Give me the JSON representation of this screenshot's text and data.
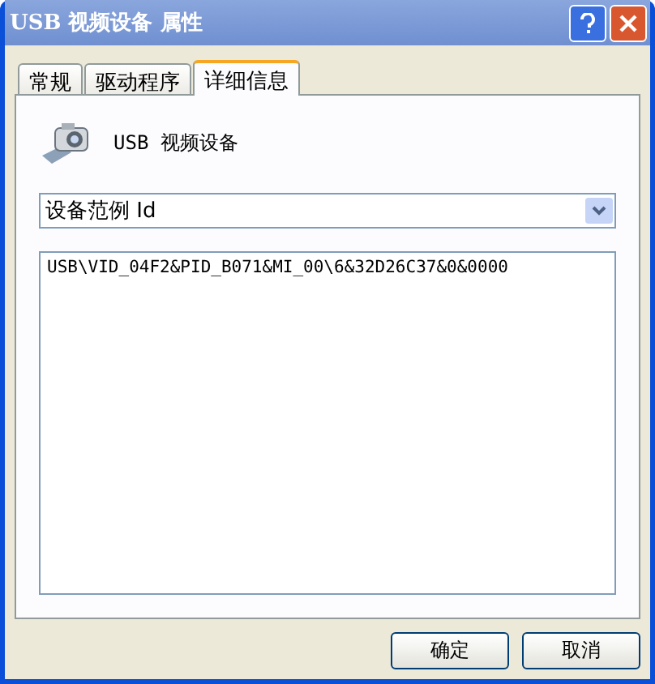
{
  "window": {
    "title": "USB 视频设备 属性"
  },
  "tabs": [
    {
      "label": "常规",
      "selected": false
    },
    {
      "label": "驱动程序",
      "selected": false
    },
    {
      "label": "详细信息",
      "selected": true
    }
  ],
  "device": {
    "name": "USB 视频设备"
  },
  "property_dropdown": {
    "value": "设备范例 Id"
  },
  "values": [
    "USB\\VID_04F2&PID_B071&MI_00\\6&32D26C37&0&0000"
  ],
  "buttons": [
    "确定",
    "取消"
  ]
}
